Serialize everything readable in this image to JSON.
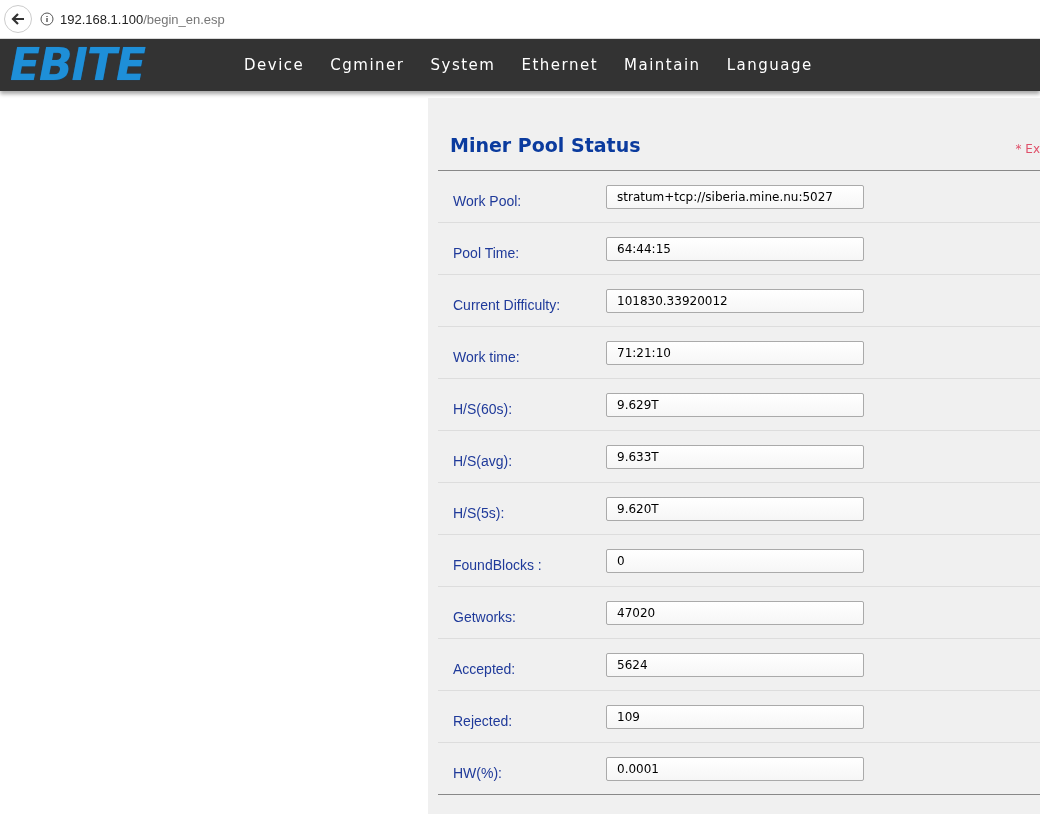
{
  "browser": {
    "url_host": "192.168.1.100",
    "url_path": "/begin_en.esp"
  },
  "nav": {
    "logo": "EBITE",
    "items": [
      "Device",
      "Cgminer",
      "System",
      "Ethernet",
      "Maintain",
      "Language"
    ]
  },
  "panel": {
    "title": "Miner Pool Status",
    "note": "* Ex",
    "rows": [
      {
        "label": "Work Pool:",
        "value": "stratum+tcp://siberia.mine.nu:5027"
      },
      {
        "label": "Pool Time:",
        "value": "64:44:15"
      },
      {
        "label": "Current Difficulty:",
        "value": "101830.33920012"
      },
      {
        "label": "Work time:",
        "value": "71:21:10"
      },
      {
        "label": "H/S(60s):",
        "value": "9.629T"
      },
      {
        "label": "H/S(avg):",
        "value": "9.633T"
      },
      {
        "label": "H/S(5s):",
        "value": "9.620T"
      },
      {
        "label": "FoundBlocks :",
        "value": "0"
      },
      {
        "label": "Getworks:",
        "value": "47020"
      },
      {
        "label": "Accepted:",
        "value": "5624"
      },
      {
        "label": "Rejected:",
        "value": "109"
      },
      {
        "label": "HW(%):",
        "value": "0.0001"
      }
    ]
  }
}
